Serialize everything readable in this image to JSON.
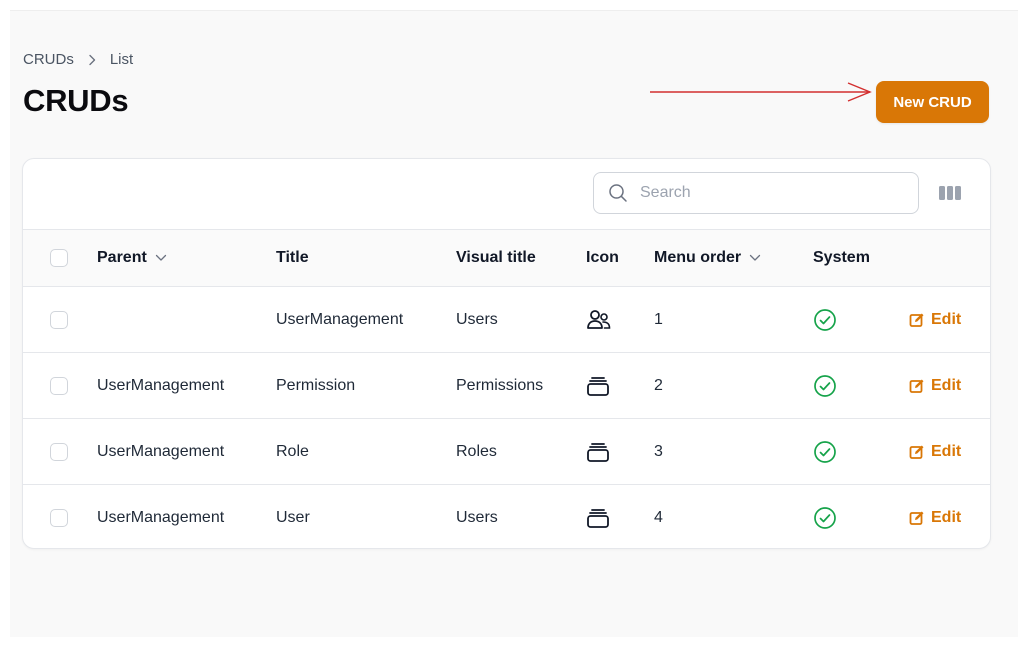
{
  "breadcrumb": {
    "items": [
      "CRUDs",
      "List"
    ]
  },
  "page": {
    "title": "CRUDs"
  },
  "actions": {
    "new_label": "New CRUD"
  },
  "search": {
    "placeholder": "Search",
    "value": ""
  },
  "table": {
    "headers": {
      "parent": "Parent",
      "title": "Title",
      "visual_title": "Visual title",
      "icon": "Icon",
      "menu_order": "Menu order",
      "system": "System"
    },
    "rows": [
      {
        "parent": "",
        "title": "UserManagement",
        "visual_title": "Users",
        "icon": "users-icon",
        "menu_order": "1",
        "system": true,
        "action": "Edit"
      },
      {
        "parent": "UserManagement",
        "title": "Permission",
        "visual_title": "Permissions",
        "icon": "stack-icon",
        "menu_order": "2",
        "system": true,
        "action": "Edit"
      },
      {
        "parent": "UserManagement",
        "title": "Role",
        "visual_title": "Roles",
        "icon": "stack-icon",
        "menu_order": "3",
        "system": true,
        "action": "Edit"
      },
      {
        "parent": "UserManagement",
        "title": "User",
        "visual_title": "Users",
        "icon": "stack-icon",
        "menu_order": "4",
        "system": true,
        "action": "Edit"
      }
    ]
  },
  "colors": {
    "accent": "#d97706",
    "success": "#16a34a",
    "annotation_arrow": "#d32f2f",
    "page_background": "#f9f9f9"
  }
}
